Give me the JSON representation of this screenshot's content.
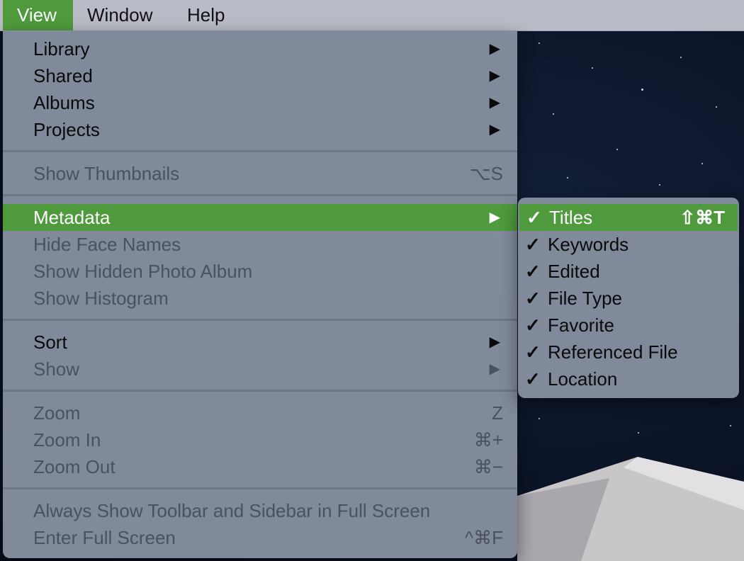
{
  "menubar": {
    "items": [
      {
        "label": "View",
        "active": true
      },
      {
        "label": "Window",
        "active": false
      },
      {
        "label": "Help",
        "active": false
      }
    ]
  },
  "view_menu": {
    "items": [
      {
        "label": "Library",
        "submenu": true,
        "enabled": true
      },
      {
        "label": "Shared",
        "submenu": true,
        "enabled": true
      },
      {
        "label": "Albums",
        "submenu": true,
        "enabled": true
      },
      {
        "label": "Projects",
        "submenu": true,
        "enabled": true
      },
      {
        "label": "Show Thumbnails",
        "shortcut": "⌥S",
        "enabled": false
      },
      {
        "label": "Metadata",
        "submenu": true,
        "enabled": true,
        "highlighted": true
      },
      {
        "label": "Hide Face Names",
        "enabled": false
      },
      {
        "label": "Show Hidden Photo Album",
        "enabled": false
      },
      {
        "label": "Show Histogram",
        "enabled": false
      },
      {
        "label": "Sort",
        "submenu": true,
        "enabled": true
      },
      {
        "label": "Show",
        "submenu": true,
        "enabled": false
      },
      {
        "label": "Zoom",
        "shortcut": "Z",
        "enabled": false
      },
      {
        "label": "Zoom In",
        "shortcut": "⌘+",
        "enabled": false
      },
      {
        "label": "Zoom Out",
        "shortcut": "⌘−",
        "enabled": false
      },
      {
        "label": "Always Show Toolbar and Sidebar in Full Screen",
        "enabled": false
      },
      {
        "label": "Enter Full Screen",
        "shortcut": "^⌘F",
        "enabled": false
      }
    ],
    "submenu_arrow": "▶"
  },
  "metadata_submenu": {
    "check_mark": "✓",
    "items": [
      {
        "label": "Titles",
        "checked": true,
        "shortcut": "⇧⌘T",
        "highlighted": true
      },
      {
        "label": "Keywords",
        "checked": true
      },
      {
        "label": "Edited",
        "checked": true
      },
      {
        "label": "File Type",
        "checked": true
      },
      {
        "label": "Favorite",
        "checked": true
      },
      {
        "label": "Referenced File",
        "checked": true
      },
      {
        "label": "Location",
        "checked": true
      }
    ]
  },
  "colors": {
    "highlight": "#4e9a3d",
    "menu_background": "#848e9e",
    "disabled_text": "#4a5160"
  }
}
